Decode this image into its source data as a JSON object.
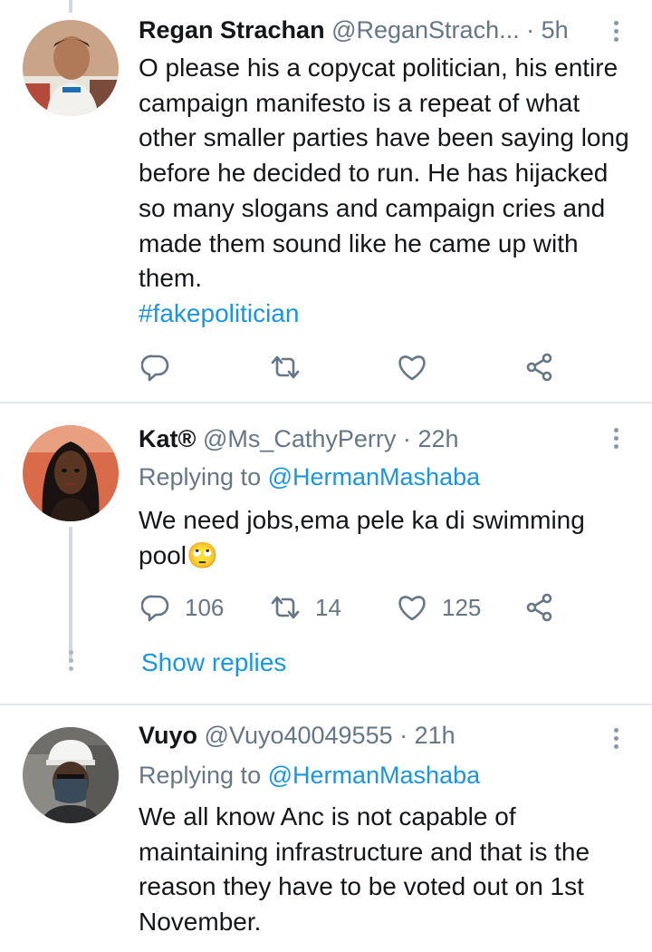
{
  "tweets": [
    {
      "name": "Regan Strachan",
      "handle": "@ReganStrach...",
      "separator": "·",
      "time": "5h",
      "text": "O please his a copycat politician, his entire campaign manifesto is a repeat of what other smaller parties have been saying long before he decided to run. He has hijacked so many slogans and campaign cries and made them sound like he came up with them.",
      "hashtag": "#fakepolitician"
    },
    {
      "name": "Kat",
      "name_badge": "®",
      "handle": "@Ms_CathyPerry",
      "separator": "·",
      "time": "22h",
      "replying_prefix": "Replying to",
      "replying_mention": "@HermanMashaba",
      "text": "We need jobs,ema pele ka di swimming pool",
      "emoji": "🙄",
      "stats": {
        "replies": "106",
        "retweets": "14",
        "likes": "125"
      },
      "show_replies": "Show replies"
    },
    {
      "name": "Vuyo",
      "handle": "@Vuyo40049555",
      "separator": "·",
      "time": "21h",
      "replying_prefix": "Replying to",
      "replying_mention": "@HermanMashaba",
      "text": "We all know Anc is not capable of maintaining infrastructure and that is the reason they have to be voted out on 1st November."
    }
  ],
  "icons": {
    "reply": "reply-icon",
    "retweet": "retweet-icon",
    "like": "heart-icon",
    "share": "share-icon",
    "more": "more-vertical-icon"
  },
  "colors": {
    "link": "#1b95e0",
    "secondary_text": "#657786",
    "icon": "#657786",
    "divider": "#e1e8ed",
    "thread_line": "#cfd9de"
  }
}
